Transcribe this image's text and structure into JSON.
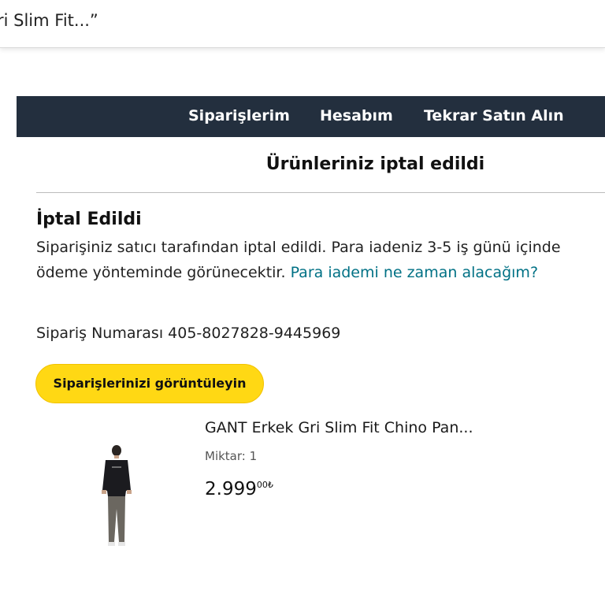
{
  "preview": {
    "text": "ri Slim Fit...”"
  },
  "nav": {
    "orders": "Siparişlerim",
    "account": "Hesabım",
    "rebuy": "Tekrar Satın Alın"
  },
  "page": {
    "title": "Ürünleriniz iptal edildi"
  },
  "status": {
    "heading": "İptal Edildi",
    "message_line1": "Siparişiniz satıcı tarafından iptal edildi. Para iadeniz 3-5 iş günü içinde",
    "message_line2": "ödeme yönteminde görünecektir.",
    "help_link": "Para iademi ne zaman alacağım?"
  },
  "order": {
    "number_text": "Sipariş Numarası 405-8027828-9445969",
    "view_orders_button": "Siparişlerinizi görüntüleyin"
  },
  "product": {
    "title": "GANT Erkek Gri Slim Fit Chino Pan...",
    "quantity": "Miktar: 1",
    "price": "2.999",
    "price_suffix": "00₺"
  },
  "colors": {
    "nav_background": "#232f3e",
    "button_yellow": "#ffd814",
    "link_teal": "#007185"
  }
}
